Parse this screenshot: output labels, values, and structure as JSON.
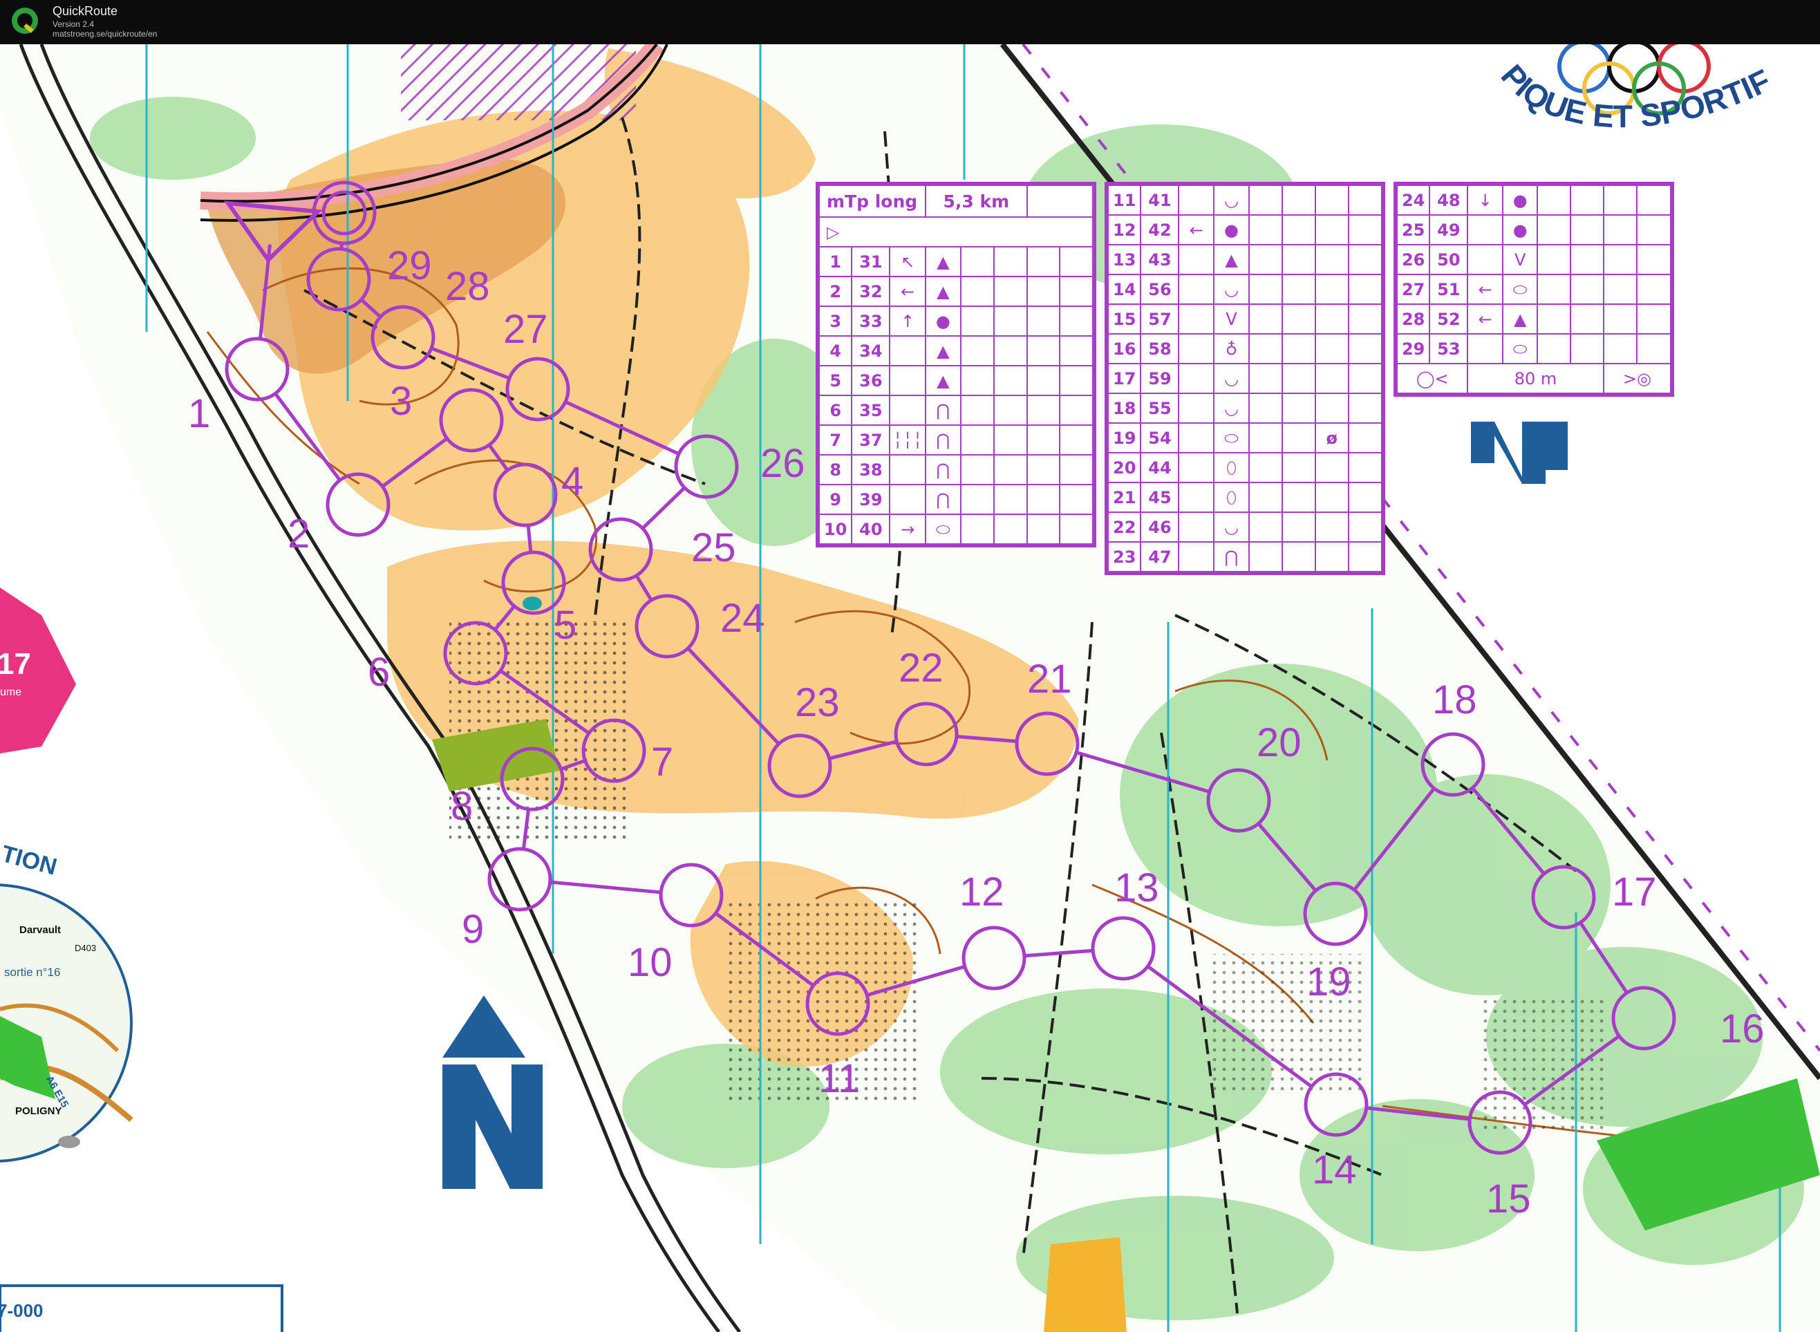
{
  "window": {
    "app_name": "QuickRoute",
    "version": "Version 2.4",
    "url": "matstroeng.se/quickroute/en"
  },
  "map": {
    "logo_text": "PIQUE ET SPORTIF FRA",
    "left_sign_text": "17",
    "left_sign_sub": "ume",
    "inset_heading": "TION",
    "inset_places": {
      "darvault": "Darvault",
      "d403": "D403",
      "exit": "sortie n°16",
      "highway": "A6 E15",
      "poligny": "POLIGNY"
    },
    "bottom_left_code": "7-000",
    "colors": {
      "course": "#a63cc8",
      "forest_yellow": "#f7c87a",
      "green": "#8fd48c",
      "north_arrow": "#1f5e99"
    }
  },
  "course": {
    "name": "mTp long",
    "length": "5,3 km",
    "start_symbol": "▷",
    "control_labels": [
      "1",
      "2",
      "3",
      "4",
      "5",
      "6",
      "7",
      "8",
      "9",
      "10",
      "11",
      "12",
      "13",
      "14",
      "15",
      "16",
      "17",
      "18",
      "19",
      "20",
      "21",
      "22",
      "23",
      "24",
      "25",
      "26",
      "27",
      "28",
      "29"
    ],
    "table1": [
      {
        "n": "1",
        "code": "31",
        "dir": "↖",
        "sym": "▲"
      },
      {
        "n": "2",
        "code": "32",
        "dir": "←",
        "sym": "▲"
      },
      {
        "n": "3",
        "code": "33",
        "dir": "↑",
        "sym": "●"
      },
      {
        "n": "4",
        "code": "34",
        "dir": "",
        "sym": "▲"
      },
      {
        "n": "5",
        "code": "36",
        "dir": "",
        "sym": "▲"
      },
      {
        "n": "6",
        "code": "35",
        "dir": "",
        "sym": "⋂"
      },
      {
        "n": "7",
        "code": "37",
        "dir": "╎╎╎",
        "sym": "⋂"
      },
      {
        "n": "8",
        "code": "38",
        "dir": "",
        "sym": "⋂"
      },
      {
        "n": "9",
        "code": "39",
        "dir": "",
        "sym": "⋂"
      },
      {
        "n": "10",
        "code": "40",
        "dir": "→",
        "sym": "⬭"
      }
    ],
    "table2": [
      {
        "n": "11",
        "code": "41",
        "dir": "",
        "sym": "◡"
      },
      {
        "n": "12",
        "code": "42",
        "dir": "←",
        "sym": "●"
      },
      {
        "n": "13",
        "code": "43",
        "dir": "",
        "sym": "▲"
      },
      {
        "n": "14",
        "code": "56",
        "dir": "",
        "sym": "◡"
      },
      {
        "n": "15",
        "code": "57",
        "dir": "",
        "sym": "ᐯ"
      },
      {
        "n": "16",
        "code": "58",
        "dir": "",
        "sym": "♁"
      },
      {
        "n": "17",
        "code": "59",
        "dir": "",
        "sym": "◡"
      },
      {
        "n": "18",
        "code": "55",
        "dir": "",
        "sym": "◡"
      },
      {
        "n": "19",
        "code": "54",
        "dir": "",
        "sym": "⬭",
        "extra": "ø"
      },
      {
        "n": "20",
        "code": "44",
        "dir": "",
        "sym": "⬯"
      },
      {
        "n": "21",
        "code": "45",
        "dir": "",
        "sym": "⬯"
      },
      {
        "n": "22",
        "code": "46",
        "dir": "",
        "sym": "◡"
      },
      {
        "n": "23",
        "code": "47",
        "dir": "",
        "sym": "⋂"
      }
    ],
    "table3": [
      {
        "n": "24",
        "code": "48",
        "dir": "↓",
        "sym": "●"
      },
      {
        "n": "25",
        "code": "49",
        "dir": "",
        "sym": "●"
      },
      {
        "n": "26",
        "code": "50",
        "dir": "",
        "sym": "V"
      },
      {
        "n": "27",
        "code": "51",
        "dir": "←",
        "sym": "⬭"
      },
      {
        "n": "28",
        "code": "52",
        "dir": "←",
        "sym": "▲"
      },
      {
        "n": "29",
        "code": "53",
        "dir": "",
        "sym": "⬭"
      }
    ],
    "finish_distance": "80 m"
  }
}
